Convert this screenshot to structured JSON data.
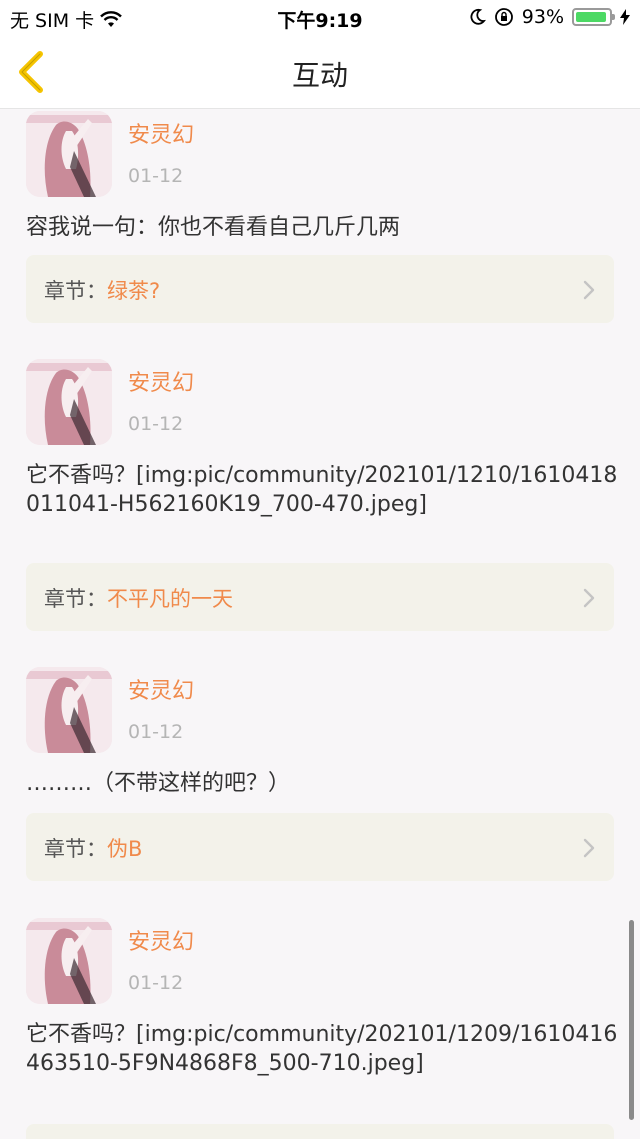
{
  "status": {
    "carrier": "无 SIM 卡",
    "time": "下午9:19",
    "battery_pct": "93%",
    "battery_level": 0.93,
    "battery_color": "#4cd964"
  },
  "nav": {
    "back_icon": "chevron-left-icon",
    "title": "互动",
    "accent": "#f5c400"
  },
  "chapter_prefix": "章节：",
  "items": [
    {
      "user": "安灵幻",
      "date": "01-12",
      "content": "容我说一句：你也不看看自己几斤几两",
      "chapter": "绿茶?"
    },
    {
      "user": "安灵幻",
      "date": "01-12",
      "content": "它不香吗？[img:pic/community/202101/1210/1610418011041-H562160K19_700-470.jpeg]",
      "chapter": "不平凡的一天"
    },
    {
      "user": "安灵幻",
      "date": "01-12",
      "content": "………（不带这样的吧？）",
      "chapter": "伪B"
    },
    {
      "user": "安灵幻",
      "date": "01-12",
      "content": "它不香吗？[img:pic/community/202101/1209/1610416463510-5F9N4868F8_500-710.jpeg]",
      "chapter": ""
    }
  ]
}
